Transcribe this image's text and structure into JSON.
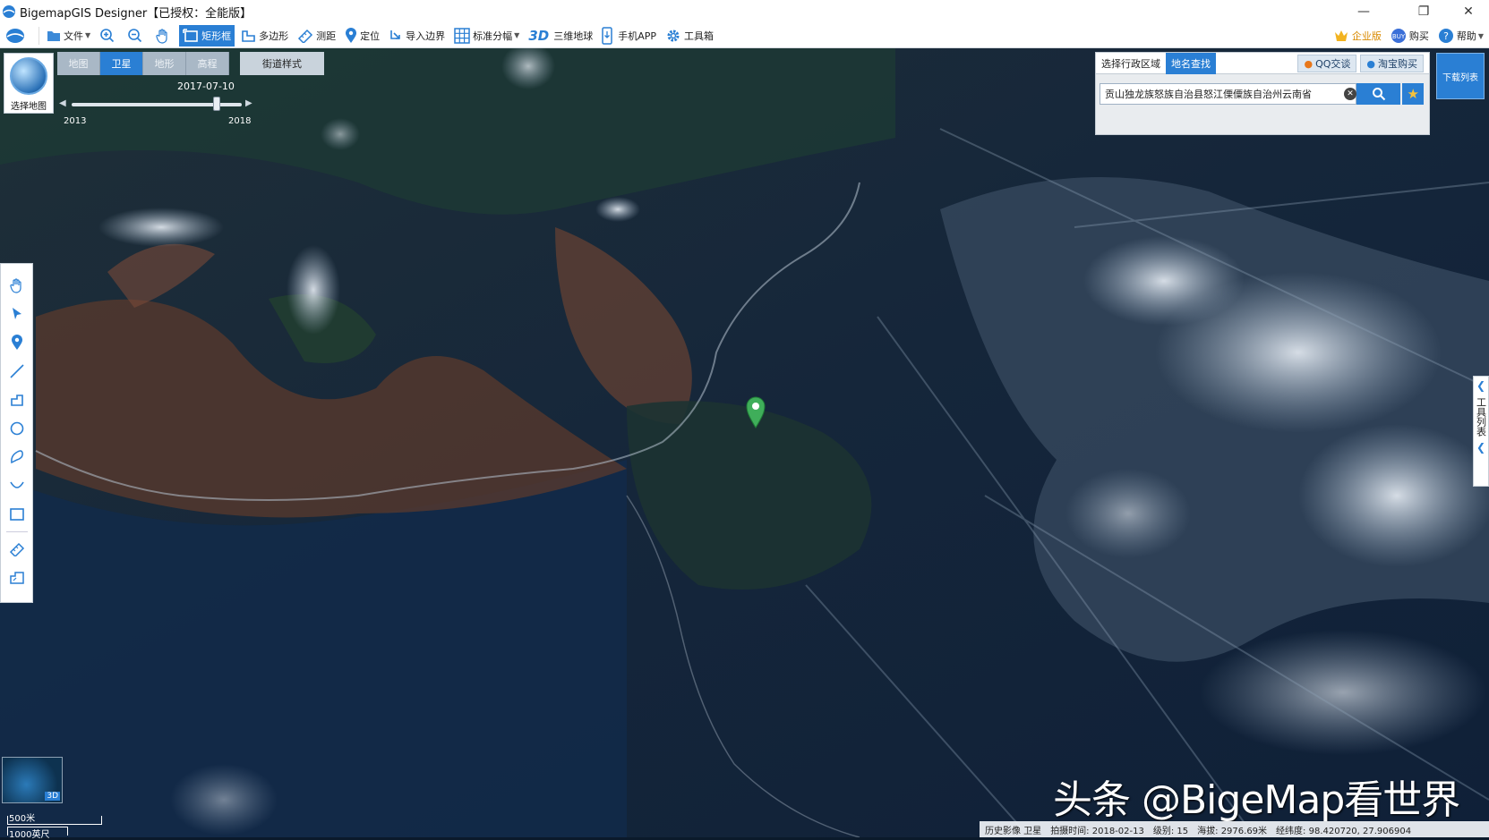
{
  "window": {
    "title": "BigemapGIS Designer【已授权：全能版】",
    "controls": [
      "minimize-icon",
      "restore-icon",
      "close-icon"
    ]
  },
  "toolbar": {
    "items": [
      {
        "label": "文件",
        "icon": "folder-icon",
        "dropdown": true
      },
      {
        "label": "",
        "icon": "zoom-in-icon"
      },
      {
        "label": "",
        "icon": "zoom-out-icon"
      },
      {
        "label": "",
        "icon": "hand-icon"
      },
      {
        "label": "矩形框",
        "icon": "rectangle-select-icon",
        "active": true
      },
      {
        "label": "多边形",
        "icon": "polygon-icon"
      },
      {
        "label": "测距",
        "icon": "ruler-icon"
      },
      {
        "label": "定位",
        "icon": "location-icon"
      },
      {
        "label": "导入边界",
        "icon": "import-boundary-icon"
      },
      {
        "label": "标准分幅",
        "icon": "grid-icon",
        "dropdown": true
      },
      {
        "label": "三维地球",
        "icon": "3d-icon",
        "icon_text": "3D"
      },
      {
        "label": "手机APP",
        "icon": "phone-icon"
      },
      {
        "label": "工具箱",
        "icon": "gear-icon"
      }
    ],
    "right": [
      {
        "label": "企业版",
        "icon": "crown-icon"
      },
      {
        "label": "购买",
        "icon": "buy-icon"
      },
      {
        "label": "帮助",
        "icon": "help-icon",
        "dropdown": true
      }
    ]
  },
  "map_select": {
    "label": "选择地图"
  },
  "map_tabs": [
    {
      "label": "地图",
      "selected": false
    },
    {
      "label": "卫星",
      "selected": true
    },
    {
      "label": "地形",
      "selected": false
    },
    {
      "label": "高程",
      "selected": false
    }
  ],
  "street_style": {
    "label": "街道样式"
  },
  "timeline": {
    "date": "2017-07-10",
    "start_year": "2013",
    "end_year": "2018",
    "position_fraction": 0.85
  },
  "search_panel": {
    "tabs": [
      {
        "label": "选择行政区域",
        "selected": false
      },
      {
        "label": "地名查找",
        "selected": true
      }
    ],
    "links": [
      {
        "label": "QQ交谈",
        "icon": "qq-icon"
      },
      {
        "label": "淘宝购买",
        "icon": "taobao-icon"
      }
    ],
    "query": "贡山独龙族怒族自治县怒江傈僳族自治州云南省"
  },
  "download_list": {
    "label": "下载列表"
  },
  "right_panel": {
    "label": "工具列表"
  },
  "scale": {
    "metric": "500米",
    "imperial": "1000英尺"
  },
  "minimap": {
    "label": "3D"
  },
  "status": {
    "source": "历史影像 卫星",
    "capture_time": "拍摄时间: 2018-02-13",
    "level": "级别:  15",
    "elevation": "海拔: 2976.69米",
    "coords": "经纬度:  98.420720, 27.906904"
  },
  "watermark": "头条 @BigeMap看世界",
  "colors": {
    "accent": "#2a7fd4",
    "pin": "#3fae5a"
  }
}
